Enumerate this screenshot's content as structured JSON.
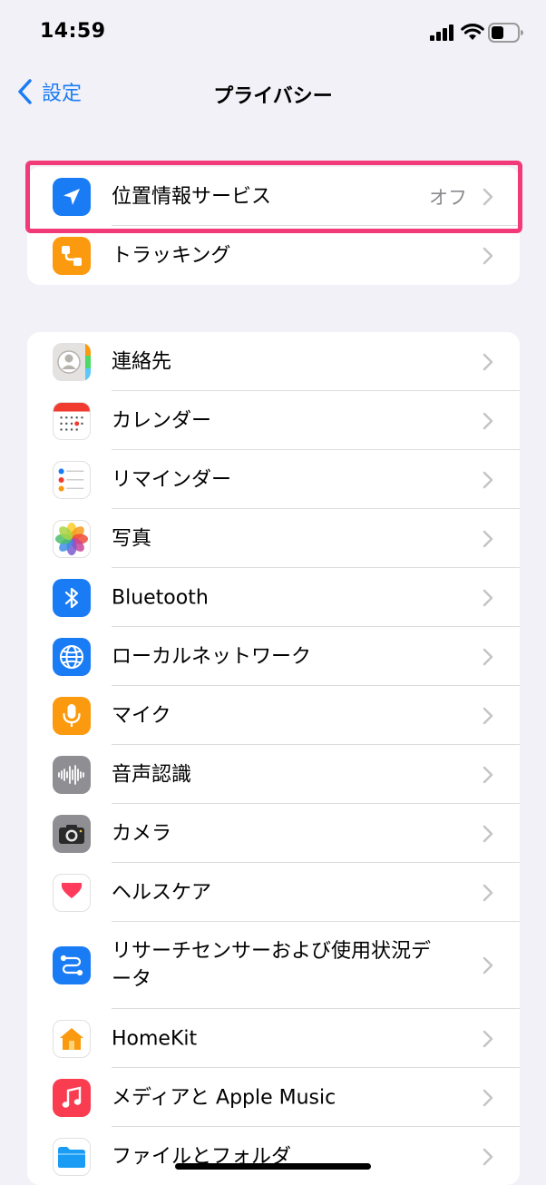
{
  "status_bar": {
    "time": "14:59"
  },
  "nav": {
    "back_label": "設定",
    "title": "プライバシー"
  },
  "group1": [
    {
      "label": "位置情報サービス",
      "value": "オフ",
      "icon": "location-arrow-icon",
      "color": "#1a7cf5"
    },
    {
      "label": "トラッキング",
      "icon": "tracking-icon",
      "color": "#fb9a0e"
    }
  ],
  "group2": [
    {
      "label": "連絡先",
      "icon": "contacts-icon"
    },
    {
      "label": "カレンダー",
      "icon": "calendar-icon"
    },
    {
      "label": "リマインダー",
      "icon": "reminders-icon"
    },
    {
      "label": "写真",
      "icon": "photos-icon"
    },
    {
      "label": "Bluetooth",
      "icon": "bluetooth-icon",
      "color": "#1a7cf5"
    },
    {
      "label": "ローカルネットワーク",
      "icon": "globe-icon",
      "color": "#1a7cf5"
    },
    {
      "label": "マイク",
      "icon": "microphone-icon",
      "color": "#fb9a0e"
    },
    {
      "label": "音声認識",
      "icon": "waveform-icon",
      "color": "#8e8e93"
    },
    {
      "label": "カメラ",
      "icon": "camera-icon",
      "color": "#8e8e93"
    },
    {
      "label": "ヘルスケア",
      "icon": "heart-icon",
      "color": "#ff3b5c"
    },
    {
      "label": "リサーチセンサーおよび使用状況データ",
      "icon": "research-icon",
      "color": "#1a7cf5"
    },
    {
      "label": "HomeKit",
      "icon": "home-icon",
      "color": "#fb9a0e"
    },
    {
      "label": "メディアと Apple Music",
      "icon": "music-icon",
      "color": "#fa3c50"
    },
    {
      "label": "ファイルとフォルダ",
      "icon": "folder-icon",
      "color": "#1a9cf5"
    }
  ]
}
